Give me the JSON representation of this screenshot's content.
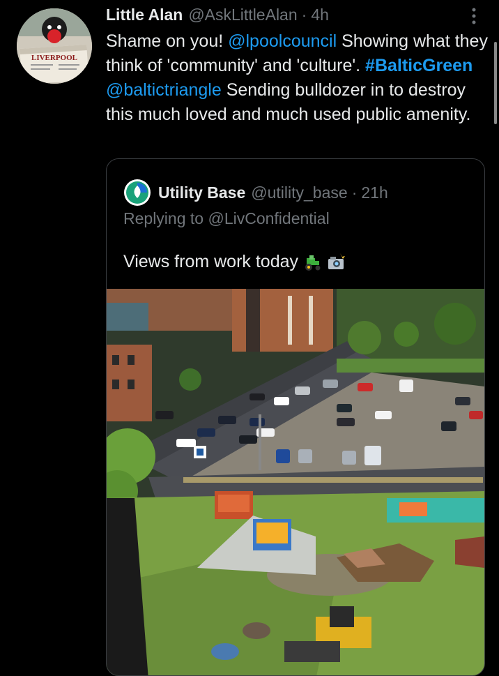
{
  "tweet": {
    "author_name": "Little Alan",
    "author_handle": "@AskLittleAlan",
    "separator": "·",
    "time": "4h",
    "avatar_icon": "reading-newspaper-avatar",
    "avatar_newspaper_text": "LIVERPOOL",
    "more_icon": "more-vertical-icon",
    "text": {
      "p1": "Shame on you! ",
      "mention1": "@lpoolcouncil",
      "p2": " Showing what they think of 'community' and 'culture'. ",
      "hashtag": "#BalticGreen",
      "p3": " ",
      "mention2": "@baltictriangle",
      "p4": " Sending bulldozer in to destroy this much loved and much used public amenity."
    }
  },
  "quoted_tweet": {
    "author_name": "Utility Base",
    "author_handle": "@utility_base",
    "separator": "·",
    "time": "21h",
    "avatar_icon": "utility-base-logo-icon",
    "reply_prefix": "Replying to ",
    "reply_mention": "@LivConfidential",
    "text": "Views from work today",
    "emojis": [
      "tractor-emoji",
      "camera-with-flash-emoji"
    ],
    "media": {
      "description_icon": "aerial-photo-car-park-green-space"
    }
  },
  "colors": {
    "background": "#000000",
    "text": "#e7e9ea",
    "muted": "#71767b",
    "link": "#1d9bf0",
    "border": "#3a3d41"
  }
}
